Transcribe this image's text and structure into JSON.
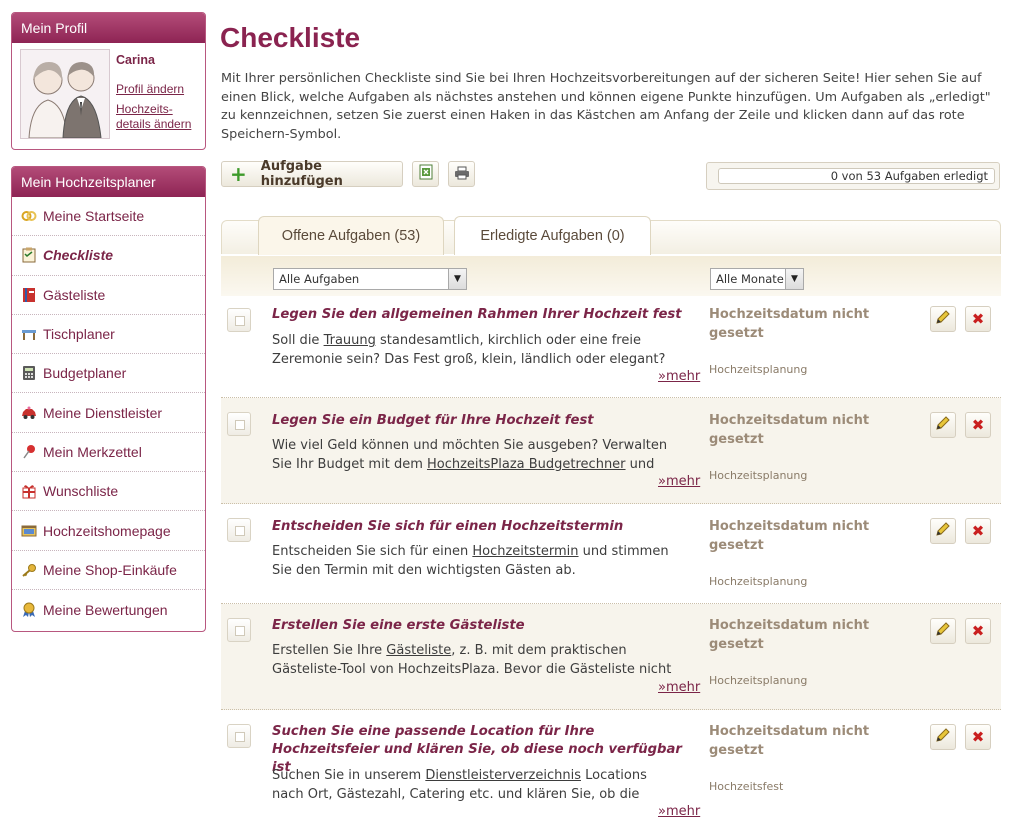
{
  "sidebar": {
    "profile": {
      "title": "Mein Profil",
      "name": "Carina",
      "edit_profile": "Profil ändern",
      "wedding_details_1": "Hochzeits-",
      "wedding_details_2": "details ändern"
    },
    "planner": {
      "title": "Mein Hochzeitsplaner",
      "items": [
        {
          "label": "Meine Startseite",
          "icon": "rings-icon"
        },
        {
          "label": "Checkliste",
          "icon": "clipboard-icon",
          "active": true
        },
        {
          "label": "Gästeliste",
          "icon": "book-icon"
        },
        {
          "label": "Tischplaner",
          "icon": "table-icon"
        },
        {
          "label": "Budgetplaner",
          "icon": "calculator-icon"
        },
        {
          "label": "Meine Dienstleister",
          "icon": "car-icon"
        },
        {
          "label": "Mein Merkzettel",
          "icon": "pin-icon"
        },
        {
          "label": "Wunschliste",
          "icon": "gift-icon"
        },
        {
          "label": "Hochzeitshomepage",
          "icon": "homepage-icon"
        },
        {
          "label": "Meine Shop-Einkäufe",
          "icon": "key-icon"
        },
        {
          "label": "Meine Bewertungen",
          "icon": "medal-icon"
        }
      ]
    }
  },
  "main": {
    "title": "Checkliste",
    "intro": "Mit Ihrer persönlichen Checkliste sind Sie bei Ihren Hochzeitsvorbereitungen auf der sicheren Seite! Hier sehen Sie auf einen Blick, welche Aufgaben als nächstes anstehen und können eigene Punkte hinzufügen. Um Aufgaben als „erledigt\" zu kennzeichnen, setzen Sie zuerst einen Haken in das Kästchen am Anfang der Zeile und klicken dann auf das rote Speichern-Symbol.",
    "toolbar": {
      "add_label": "Aufgabe hinzufügen",
      "progress_text": "0 von 53 Aufgaben erledigt",
      "progress_fraction": 0
    },
    "tabs": [
      {
        "label": "Offene Aufgaben (53)",
        "active": true
      },
      {
        "label": "Erledigte Aufgaben (0)",
        "active": false
      }
    ],
    "filters": {
      "tasks_selected": "Alle Aufgaben",
      "months_selected": "Alle Monate"
    },
    "more_label": "»mehr",
    "tasks": [
      {
        "title": "Legen Sie den allgemeinen Rahmen Ihrer Hochzeit fest",
        "desc_pre": "Soll die ",
        "desc_link": "Trauung",
        "desc_post": " standesamtlich, kirchlich oder eine freie Zeremonie sein? Das Fest groß, klein, ländlich oder elegant?",
        "date": "Hochzeitsdatum nicht gesetzt",
        "category": "Hochzeitsplanung"
      },
      {
        "title": "Legen Sie ein Budget für Ihre Hochzeit fest",
        "desc_pre": "Wie viel Geld können und möchten Sie ausgeben? Verwalten Sie Ihr Budget mit dem ",
        "desc_link": "HochzeitsPlaza Budgetrechner",
        "desc_post": " und behalten",
        "date": "Hochzeitsdatum nicht gesetzt",
        "category": "Hochzeitsplanung"
      },
      {
        "title": "Entscheiden Sie sich für einen Hochzeitstermin",
        "desc_pre": "Entscheiden Sie sich für einen ",
        "desc_link": "Hochzeitstermin",
        "desc_post": " und stimmen Sie den Termin mit den wichtigsten Gästen ab.",
        "date": "Hochzeitsdatum nicht gesetzt",
        "category": "Hochzeitsplanung"
      },
      {
        "title": "Erstellen Sie eine erste Gästeliste",
        "desc_pre": "Erstellen Sie Ihre ",
        "desc_link": "Gästeliste",
        "desc_post": ", z. B. mit dem praktischen Gästeliste-Tool von HochzeitsPlaza. Bevor die Gästeliste nicht",
        "date": "Hochzeitsdatum nicht gesetzt",
        "category": "Hochzeitsplanung"
      },
      {
        "title": "Suchen Sie eine passende Location für Ihre Hochzeitsfeier und klären Sie, ob diese noch verfügbar ist",
        "desc_pre": "Suchen Sie in unserem ",
        "desc_link": "Dienstleisterverzeichnis",
        "desc_post": " Locations nach Ort, Gästezahl, Catering etc. und klären Sie, ob die Location",
        "date": "Hochzeitsdatum nicht gesetzt",
        "category": "Hochzeitsfest"
      }
    ]
  }
}
